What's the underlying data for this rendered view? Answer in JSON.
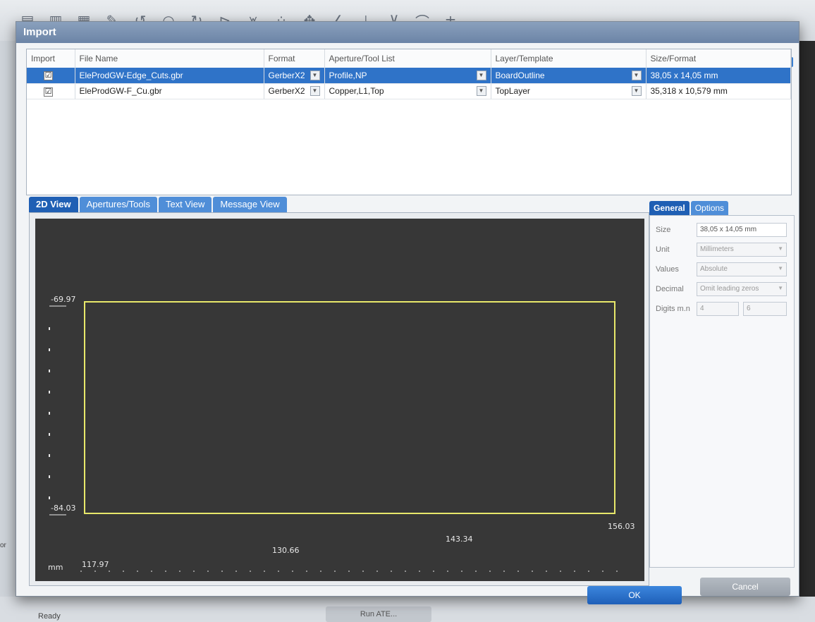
{
  "dialog": {
    "title": "Import"
  },
  "file_table": {
    "columns": [
      "Import",
      "File Name",
      "Format",
      "Aperture/Tool List",
      "Layer/Template",
      "Size/Format"
    ],
    "rows": [
      {
        "checked": "☑",
        "file_name": "EleProdGW-Edge_Cuts.gbr",
        "format": "GerberX2",
        "aperture": "Profile,NP",
        "layer": "BoardOutline",
        "size": "38,05 x 14,05 mm"
      },
      {
        "checked": "☑",
        "file_name": "EleProdGW-F_Cu.gbr",
        "format": "GerberX2",
        "aperture": "Copper,L1,Top",
        "layer": "TopLayer",
        "size": "35,318 x 10,579 mm"
      }
    ]
  },
  "view_tabs": [
    "2D View",
    "Apertures/Tools",
    "Text View",
    "Message View"
  ],
  "view": {
    "y_top": "-69.97",
    "y_bottom": "-84.03",
    "unit": "mm",
    "x_ticks": [
      "117.97",
      "130.66",
      "143.34",
      "156.03"
    ]
  },
  "props": {
    "tabs": [
      "General",
      "Options"
    ],
    "size_label": "Size",
    "size_value": "38,05 x 14,05 mm",
    "unit_label": "Unit",
    "unit_value": "Millimeters",
    "values_label": "Values",
    "values_value": "Absolute",
    "decimal_label": "Decimal",
    "decimal_value": "Omit leading zeros",
    "digits_label": "Digits m.n",
    "digits_m": "4",
    "digits_n": "6"
  },
  "buttons": {
    "ok": "OK",
    "cancel": "Cancel"
  },
  "background": {
    "run_label": "Run ATE...",
    "status": "Ready",
    "left_label": "or"
  },
  "colors": {
    "selection": "#2f73c8",
    "outline": "#e8e86a",
    "canvas": "#373737"
  }
}
